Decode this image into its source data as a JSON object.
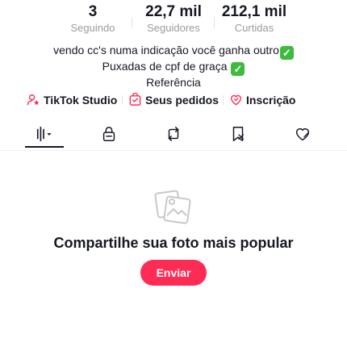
{
  "stats": [
    {
      "value": "3",
      "label": "Seguindo"
    },
    {
      "value": "22,7 mil",
      "label": "Seguidores"
    },
    {
      "value": "212,1 mil",
      "label": "Curtidas"
    }
  ],
  "bio": {
    "line1": "vendo cc's numa indicação você ganha outro",
    "line2": "Puxadas de cpf de graça",
    "line3": "Referência",
    "check_glyph": "✓"
  },
  "links": {
    "studio": "TikTok Studio",
    "orders": "Seus pedidos",
    "subscription": "Inscrição"
  },
  "tabs": [
    {
      "name": "videos",
      "icon": "grid-icon",
      "active": true
    },
    {
      "name": "private",
      "icon": "lock-icon",
      "active": false
    },
    {
      "name": "reposts",
      "icon": "repost-icon",
      "active": false
    },
    {
      "name": "favorites",
      "icon": "bookmark-icon",
      "active": false
    },
    {
      "name": "liked",
      "icon": "heart-icon",
      "active": false
    }
  ],
  "empty": {
    "icon": "photo-stack-icon",
    "title": "Compartilhe sua foto mais popular",
    "button": "Enviar"
  },
  "colors": {
    "accent": "#fe2c55",
    "check": "#3dbb3d",
    "text": "#161823",
    "muted": "#9a9ba0"
  }
}
